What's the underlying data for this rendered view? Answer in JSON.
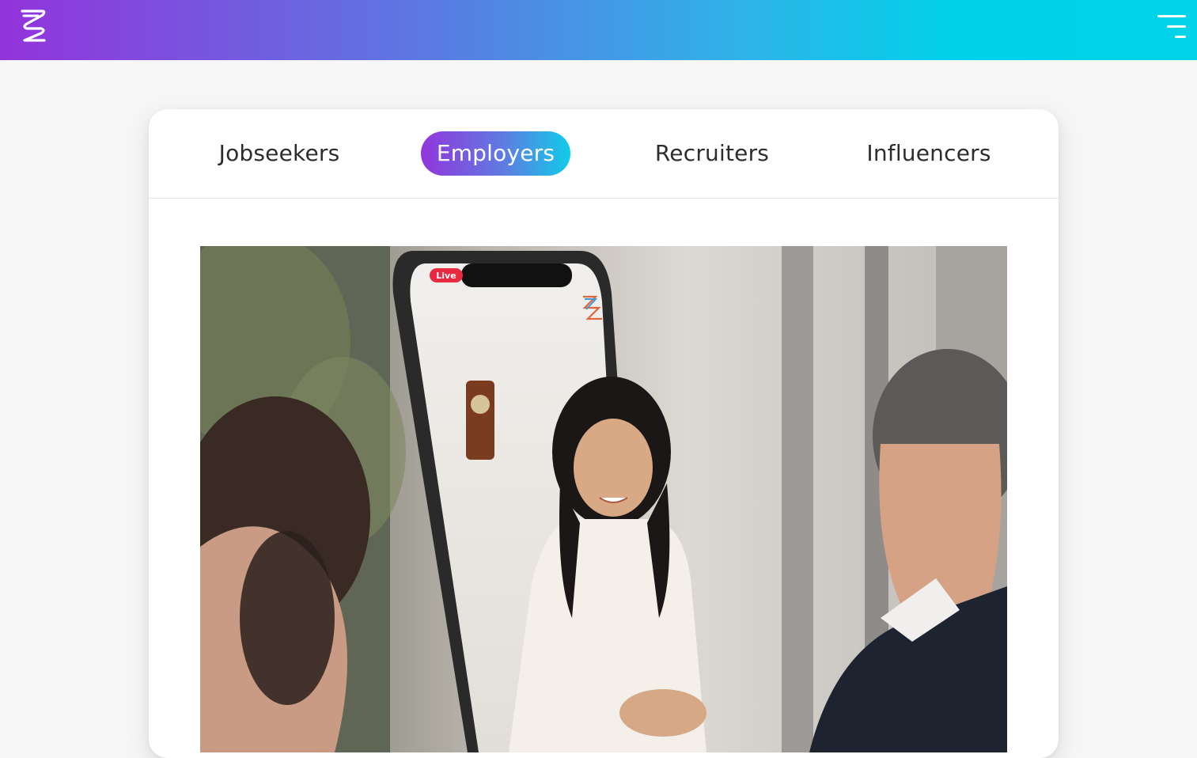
{
  "header": {
    "logo_icon": "z-logo-icon",
    "menu_icon": "hamburger-menu-icon",
    "gradient_colors": [
      "#9333db",
      "#00d2e9"
    ]
  },
  "tabs": [
    {
      "label": "Jobseekers",
      "active": false
    },
    {
      "label": "Employers",
      "active": true
    },
    {
      "label": "Recruiters",
      "active": false
    },
    {
      "label": "Influencers",
      "active": false
    }
  ],
  "hero_image": {
    "badge": "Live",
    "subject": "employer-live-video-interview-photo"
  }
}
